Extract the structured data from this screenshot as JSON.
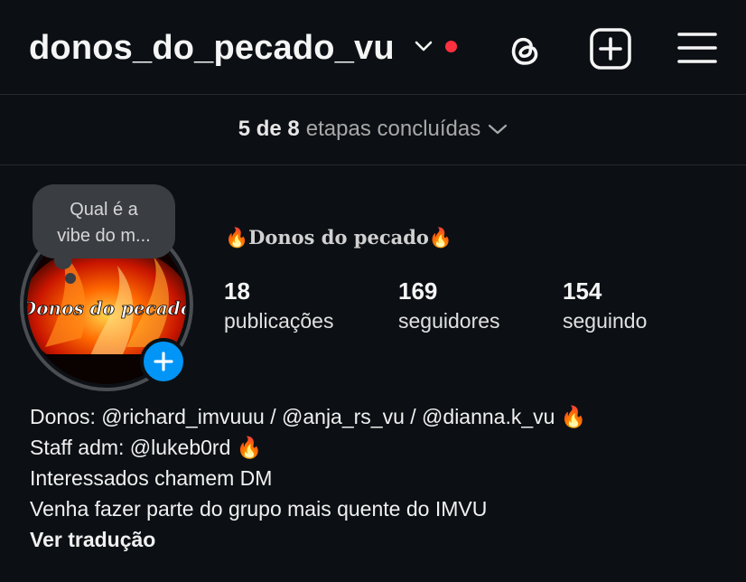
{
  "header": {
    "username": "donos_do_pecado_vu",
    "notification_color": "#ff3040"
  },
  "steps": {
    "done_text": "5 de 8",
    "rest_text": "etapas concluídas"
  },
  "profile": {
    "note_line1": "Qual é a",
    "note_line2": "vibe do m...",
    "avatar_text": "Donos do pecado",
    "display_name": "🔥Donos do pecado🔥",
    "stats": [
      {
        "value": "18",
        "label": "publicações"
      },
      {
        "value": "169",
        "label": "seguidores"
      },
      {
        "value": "154",
        "label": "seguindo"
      }
    ]
  },
  "bio": {
    "lines": [
      "Donos: @richard_imvuuu / @anja_rs_vu / @dianna.k_vu 🔥",
      "Staff adm: @lukeb0rd 🔥",
      "Interessados chamem DM",
      "Venha fazer parte do grupo mais quente do IMVU"
    ],
    "translate_link": "Ver tradução"
  },
  "colors": {
    "background": "#0c1014",
    "accent": "#0095f6"
  },
  "icons": [
    "chevron-down-icon",
    "threads-icon",
    "new-post-icon",
    "menu-icon",
    "add-story-icon"
  ]
}
